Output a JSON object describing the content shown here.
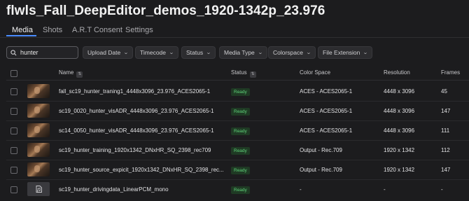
{
  "page": {
    "title": "flwls_Fall_DeepEditor_demos_1920-1342p_23.976"
  },
  "tabs": [
    {
      "label": "Media"
    },
    {
      "label": "Shots"
    },
    {
      "label": "A.R.T Consent"
    },
    {
      "label": "Settings"
    }
  ],
  "search": {
    "value": "hunter",
    "icon": "search-icon"
  },
  "filters": [
    {
      "label": "Upload Date"
    },
    {
      "label": "Timecode"
    },
    {
      "label": "Status"
    },
    {
      "label": "Media Type"
    },
    {
      "label": "Colorspace"
    },
    {
      "label": "File Extension"
    }
  ],
  "table": {
    "columns": {
      "name": "Name",
      "status": "Status",
      "color_space": "Color Space",
      "resolution": "Resolution",
      "frames": "Frames"
    },
    "rows": [
      {
        "type": "video",
        "name": "fall_sc19_hunter_traning1_4448x3096_23.976_ACES2065-1",
        "status": "Ready",
        "color_space": "ACES - ACES2065-1",
        "resolution": "4448 x 3096",
        "frames": "45"
      },
      {
        "type": "video",
        "name": "sc19_0020_hunter_visADR_4448x3096_23.976_ACES2065-1",
        "status": "Ready",
        "color_space": "ACES - ACES2065-1",
        "resolution": "4448 x 3096",
        "frames": "147"
      },
      {
        "type": "video",
        "name": "sc14_0050_hunter_visADR_4448x3096_23.976_ACES2065-1",
        "status": "Ready",
        "color_space": "ACES - ACES2065-1",
        "resolution": "4448 x 3096",
        "frames": "111"
      },
      {
        "type": "video",
        "name": "sc19_hunter_training_1920x1342_DNxHR_SQ_2398_rec709",
        "status": "Ready",
        "color_space": "Output - Rec.709",
        "resolution": "1920 x 1342",
        "frames": "112"
      },
      {
        "type": "video",
        "name": "sc19_hunter_source_expicit_1920x1342_DNxHR_SQ_2398_rec...",
        "status": "Ready",
        "color_space": "Output - Rec.709",
        "resolution": "1920 x 1342",
        "frames": "147"
      },
      {
        "type": "audio",
        "name": "sc19_hunter_drivingdata_LinearPCM_mono",
        "status": "Ready",
        "color_space": "-",
        "resolution": "-",
        "frames": "-"
      }
    ]
  },
  "colors": {
    "accent": "#4a8cff",
    "ready_bg": "#1f3a24",
    "ready_text": "#5fd27a",
    "background": "#1c1c1e"
  }
}
